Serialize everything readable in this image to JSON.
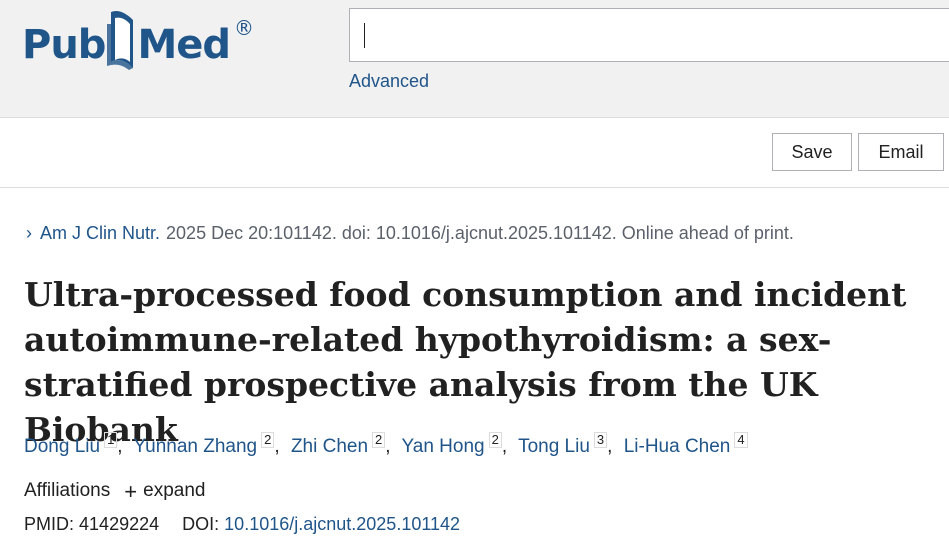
{
  "header": {
    "logo": {
      "part1": "Pub",
      "part2": "Med",
      "registered": "®"
    },
    "search": {
      "value": "",
      "placeholder": ""
    },
    "advanced_label": "Advanced"
  },
  "actions": {
    "save_label": "Save",
    "email_label": "Email"
  },
  "citation": {
    "journal": "Am J Clin Nutr.",
    "details": "2025 Dec 20:101142. doi: 10.1016/j.ajcnut.2025.101142. Online ahead of print."
  },
  "article": {
    "title": "Ultra-processed food consumption and incident autoimmune-related hypothyroidism: a sex-stratified prospective analysis from the UK Biobank"
  },
  "authors": [
    {
      "name": "Dong Liu",
      "aff": "1"
    },
    {
      "name": "Yunnan Zhang",
      "aff": "2"
    },
    {
      "name": "Zhi Chen",
      "aff": "2"
    },
    {
      "name": "Yan Hong",
      "aff": "2"
    },
    {
      "name": "Tong Liu",
      "aff": "3"
    },
    {
      "name": "Li-Hua Chen",
      "aff": "4"
    }
  ],
  "affiliations": {
    "label": "Affiliations",
    "expand_label": "expand"
  },
  "identifiers": {
    "pmid_label": "PMID:",
    "pmid": "41429224",
    "doi_label": "DOI:",
    "doi": "10.1016/j.ajcnut.2025.101142"
  },
  "colors": {
    "brand": "#20558a",
    "header_bg": "#f1f1f1"
  }
}
